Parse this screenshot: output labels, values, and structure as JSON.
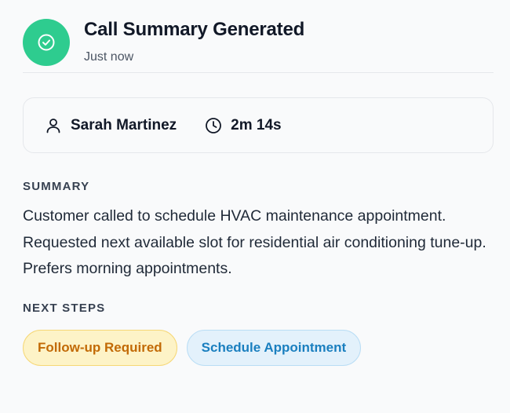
{
  "header": {
    "title": "Call Summary Generated",
    "timestamp": "Just now",
    "status_icon": "check-circle-icon",
    "status_color": "#2ecc8f"
  },
  "call_meta": {
    "caller_icon": "person-icon",
    "caller_name": "Sarah Martinez",
    "duration_icon": "clock-icon",
    "duration": "2m 14s"
  },
  "summary": {
    "heading": "SUMMARY",
    "text": "Customer called to schedule HVAC maintenance appointment. Requested next available slot for residential air conditioning tune-up. Prefers morning appointments."
  },
  "next_steps": {
    "heading": "NEXT STEPS",
    "tags": [
      {
        "label": "Follow-up Required",
        "color": "#c26a06"
      },
      {
        "label": "Schedule Appointment",
        "color": "#1a7fbf"
      }
    ]
  }
}
